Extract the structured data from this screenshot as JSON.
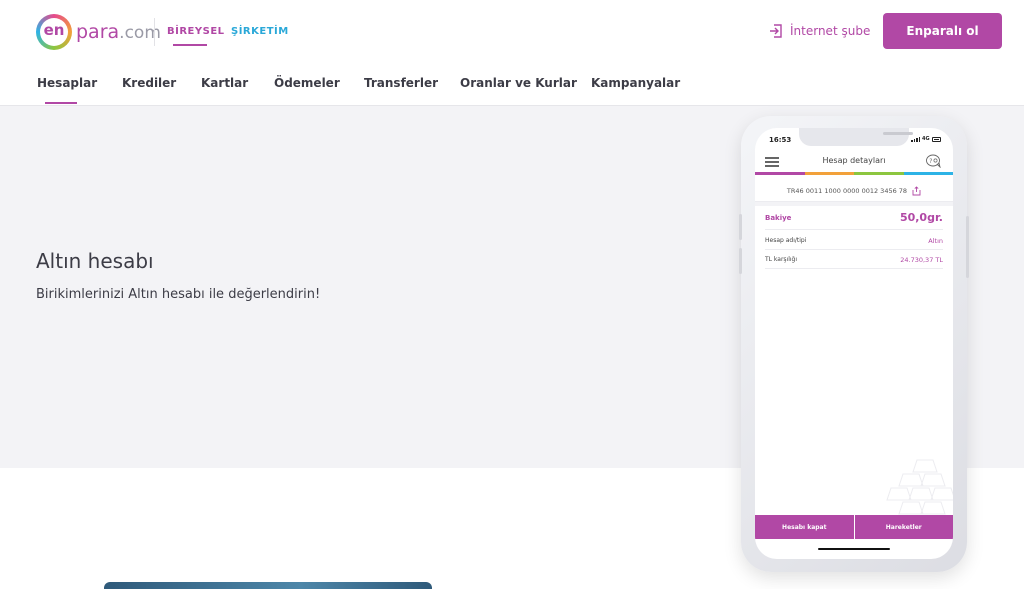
{
  "header": {
    "logo": {
      "en": "en",
      "para": "para",
      "com": ".com"
    },
    "segments": {
      "bireysel": "BİREYSEL",
      "sirketim": "ŞİRKETİM"
    },
    "internet_sube": "İnternet şube",
    "cta": "Enparalı ol"
  },
  "nav": {
    "items": [
      {
        "label": "Hesaplar",
        "active": true
      },
      {
        "label": "Krediler"
      },
      {
        "label": "Kartlar"
      },
      {
        "label": "Ödemeler"
      },
      {
        "label": "Transferler"
      },
      {
        "label": "Oranlar ve Kurlar"
      },
      {
        "label": "Kampanyalar"
      }
    ]
  },
  "hero": {
    "title": "Altın hesabı",
    "subtitle": "Birikimlerinizi Altın hesabı ile değerlendirin!"
  },
  "phone": {
    "status": {
      "time": "16:53",
      "network": "4G"
    },
    "title": "Hesap detayları",
    "iban": "TR46 0011 1000 0000 0012 3456 78",
    "bakiye_label": "Bakiye",
    "bakiye_value": "50,0gr.",
    "rows": [
      {
        "label": "Hesap adı/tipi",
        "value": "Altın"
      },
      {
        "label": "TL karşılığı",
        "value": "24.730,37 TL"
      }
    ],
    "buttons": {
      "close": "Hesabı kapat",
      "history": "Hareketler"
    }
  },
  "colors": {
    "brand": "#b148a5",
    "secondary": "#2aa8d8",
    "hero_bg": "#f3f3f6",
    "stripe": [
      "#b148a5",
      "#f2a13a",
      "#8cc63f",
      "#2db3e6"
    ]
  }
}
